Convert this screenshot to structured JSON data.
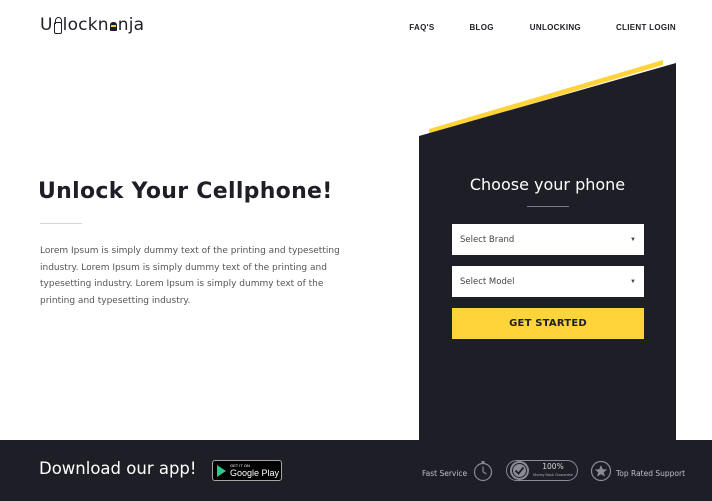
{
  "header": {
    "logo_text_prefix": "U",
    "logo_text_mid": "lockn",
    "logo_text_suffix": "nja",
    "nav": [
      "FAQ'S",
      "BLOG",
      "UNLOCKING",
      "CLIENT LOGIN"
    ]
  },
  "hero": {
    "title": "Unlock Your Cellphone!",
    "body": "Lorem Ipsum is simply dummy text of the printing and typesetting industry. Lorem Ipsum is simply dummy text of the printing and typesetting industry. Lorem Ipsum is simply dummy text of the printing and typesetting industry."
  },
  "panel": {
    "title": "Choose your phone",
    "brand_select": "Select Brand",
    "model_select": "Select Model",
    "cta": "GET STARTED"
  },
  "footer": {
    "title": "Download our app!",
    "google_play_small": "GET IT ON",
    "google_play_big": "Google Play",
    "features": {
      "fast_service": "Fast Service",
      "money_back_big": "100%",
      "money_back_small": "Money Back Guarantee",
      "top_rated": "Top Rated Support"
    }
  },
  "colors": {
    "dark": "#1d1e26",
    "accent": "#ffd43b",
    "white": "#ffffff"
  },
  "icons": [
    "stopwatch-icon",
    "medal-icon",
    "star-icon",
    "caret-down-icon",
    "google-play-icon"
  ]
}
